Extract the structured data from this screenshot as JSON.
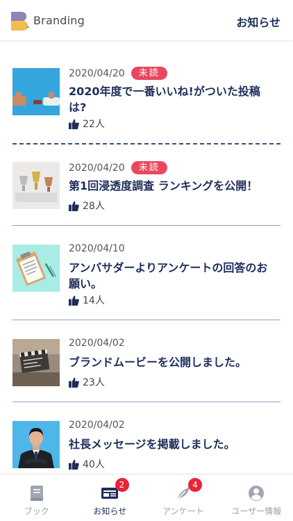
{
  "header": {
    "brand": "Branding",
    "title": "お知らせ",
    "colors": {
      "logo_pink": "#e8578a",
      "logo_blue": "#4aa6d8",
      "logo_yellow": "#f5c842"
    }
  },
  "feed": {
    "items": [
      {
        "date": "2020/04/20",
        "badge": "未読",
        "title": "2020年度で一番いいね!がついた投稿は?",
        "likes": "22人",
        "thumb_icon": "thumbs-up-photo"
      },
      {
        "date": "2020/04/20",
        "badge": "未読",
        "title": "第1回浸透度調査 ランキングを公開！",
        "likes": "28人",
        "thumb_icon": "trophies-photo"
      },
      {
        "date": "2020/04/10",
        "badge": "",
        "title": "アンバサダーよりアンケートの回答のお願い。",
        "likes": "14人",
        "thumb_icon": "clipboard-photo"
      },
      {
        "date": "2020/04/02",
        "badge": "",
        "title": "ブランドムービーを公開しました。",
        "likes": "23人",
        "thumb_icon": "clapperboard-photo"
      },
      {
        "date": "2020/04/02",
        "badge": "",
        "title": "社長メッセージを掲載しました。",
        "likes": "40人",
        "thumb_icon": "ceo-portrait-photo"
      }
    ]
  },
  "tabbar": {
    "tabs": [
      {
        "label": "ブック",
        "icon": "book-icon",
        "badge": ""
      },
      {
        "label": "お知らせ",
        "icon": "news-icon",
        "badge": "2",
        "active": true
      },
      {
        "label": "アンケート",
        "icon": "feather-icon",
        "badge": "4"
      },
      {
        "label": "ユーザー情報",
        "icon": "user-icon",
        "badge": ""
      }
    ]
  },
  "colors": {
    "accent": "#1f2d5a",
    "unread_badge": "#e8485f",
    "tab_badge": "#e8233a"
  }
}
